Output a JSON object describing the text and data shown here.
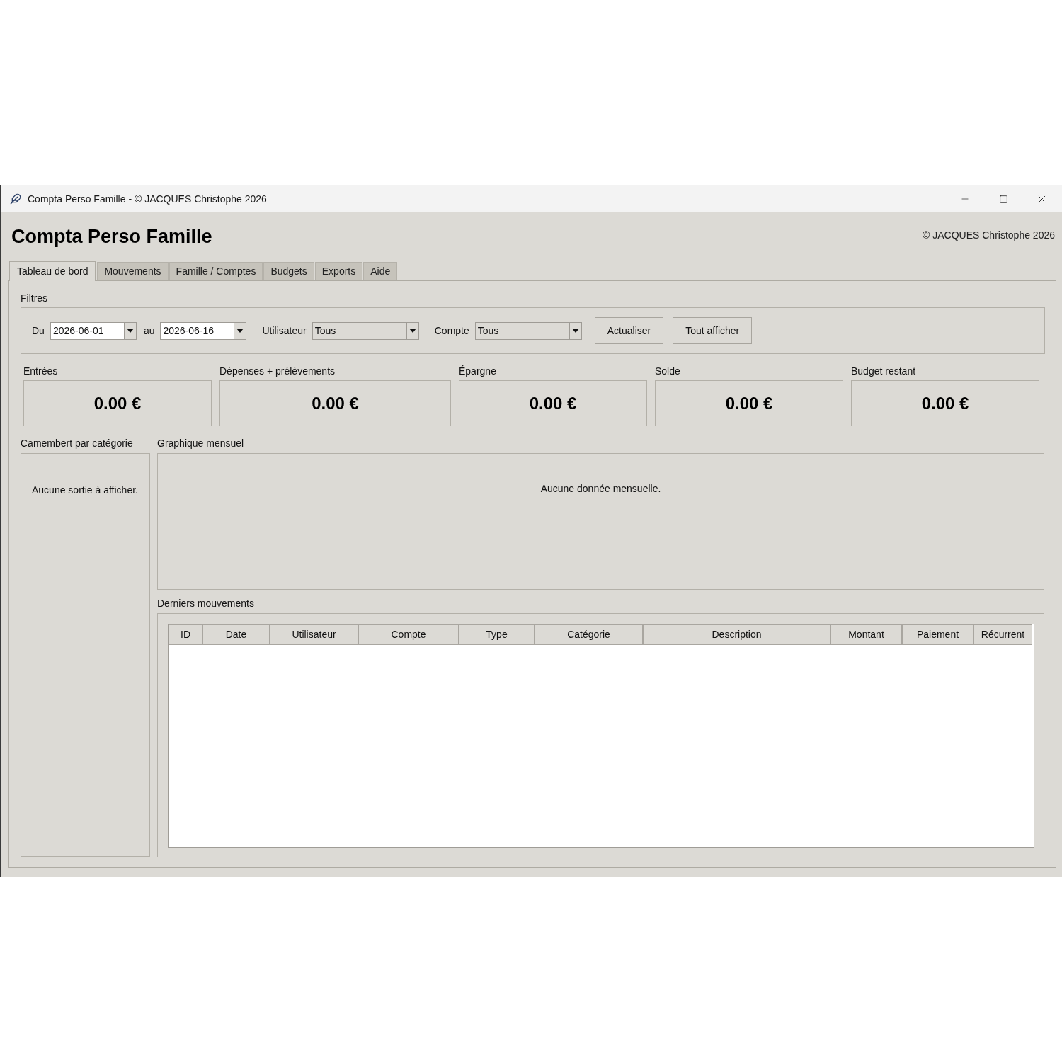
{
  "window": {
    "title": "Compta Perso Famille - © JACQUES Christophe 2026"
  },
  "header": {
    "title": "Compta Perso Famille",
    "copyright": "© JACQUES Christophe 2026"
  },
  "tabs": [
    {
      "label": "Tableau de bord",
      "selected": true
    },
    {
      "label": "Mouvements",
      "selected": false
    },
    {
      "label": "Famille / Comptes",
      "selected": false
    },
    {
      "label": "Budgets",
      "selected": false
    },
    {
      "label": "Exports",
      "selected": false
    },
    {
      "label": "Aide",
      "selected": false
    }
  ],
  "filters": {
    "title": "Filtres",
    "fields": [
      {
        "kind": "date",
        "label": "Du",
        "value": "2026-06-01"
      },
      {
        "kind": "date",
        "label": "au",
        "value": "2026-06-16"
      },
      {
        "kind": "select",
        "label": "Utilisateur",
        "value": "Tous"
      },
      {
        "kind": "select",
        "label": "Compte",
        "value": "Tous"
      }
    ],
    "buttons": [
      "Actualiser",
      "Tout afficher"
    ]
  },
  "summary_cards": [
    {
      "label": "Entrées",
      "value": "0.00 €"
    },
    {
      "label": "Dépenses + prélèvements",
      "value": "0.00 €"
    },
    {
      "label": "Épargne",
      "value": "0.00 €"
    },
    {
      "label": "Solde",
      "value": "0.00 €"
    },
    {
      "label": "Budget restant",
      "value": "0.00 €"
    }
  ],
  "pie_panel": {
    "title": "Camembert par catégorie",
    "message": "Aucune sortie à afficher."
  },
  "monthly_chart": {
    "title": "Graphique mensuel",
    "message": "Aucune donnée mensuelle."
  },
  "recent_movements": {
    "title": "Derniers mouvements",
    "columns": [
      "ID",
      "Date",
      "Utilisateur",
      "Compte",
      "Type",
      "Catégorie",
      "Description",
      "Montant",
      "Paiement",
      "Récurrent"
    ]
  }
}
